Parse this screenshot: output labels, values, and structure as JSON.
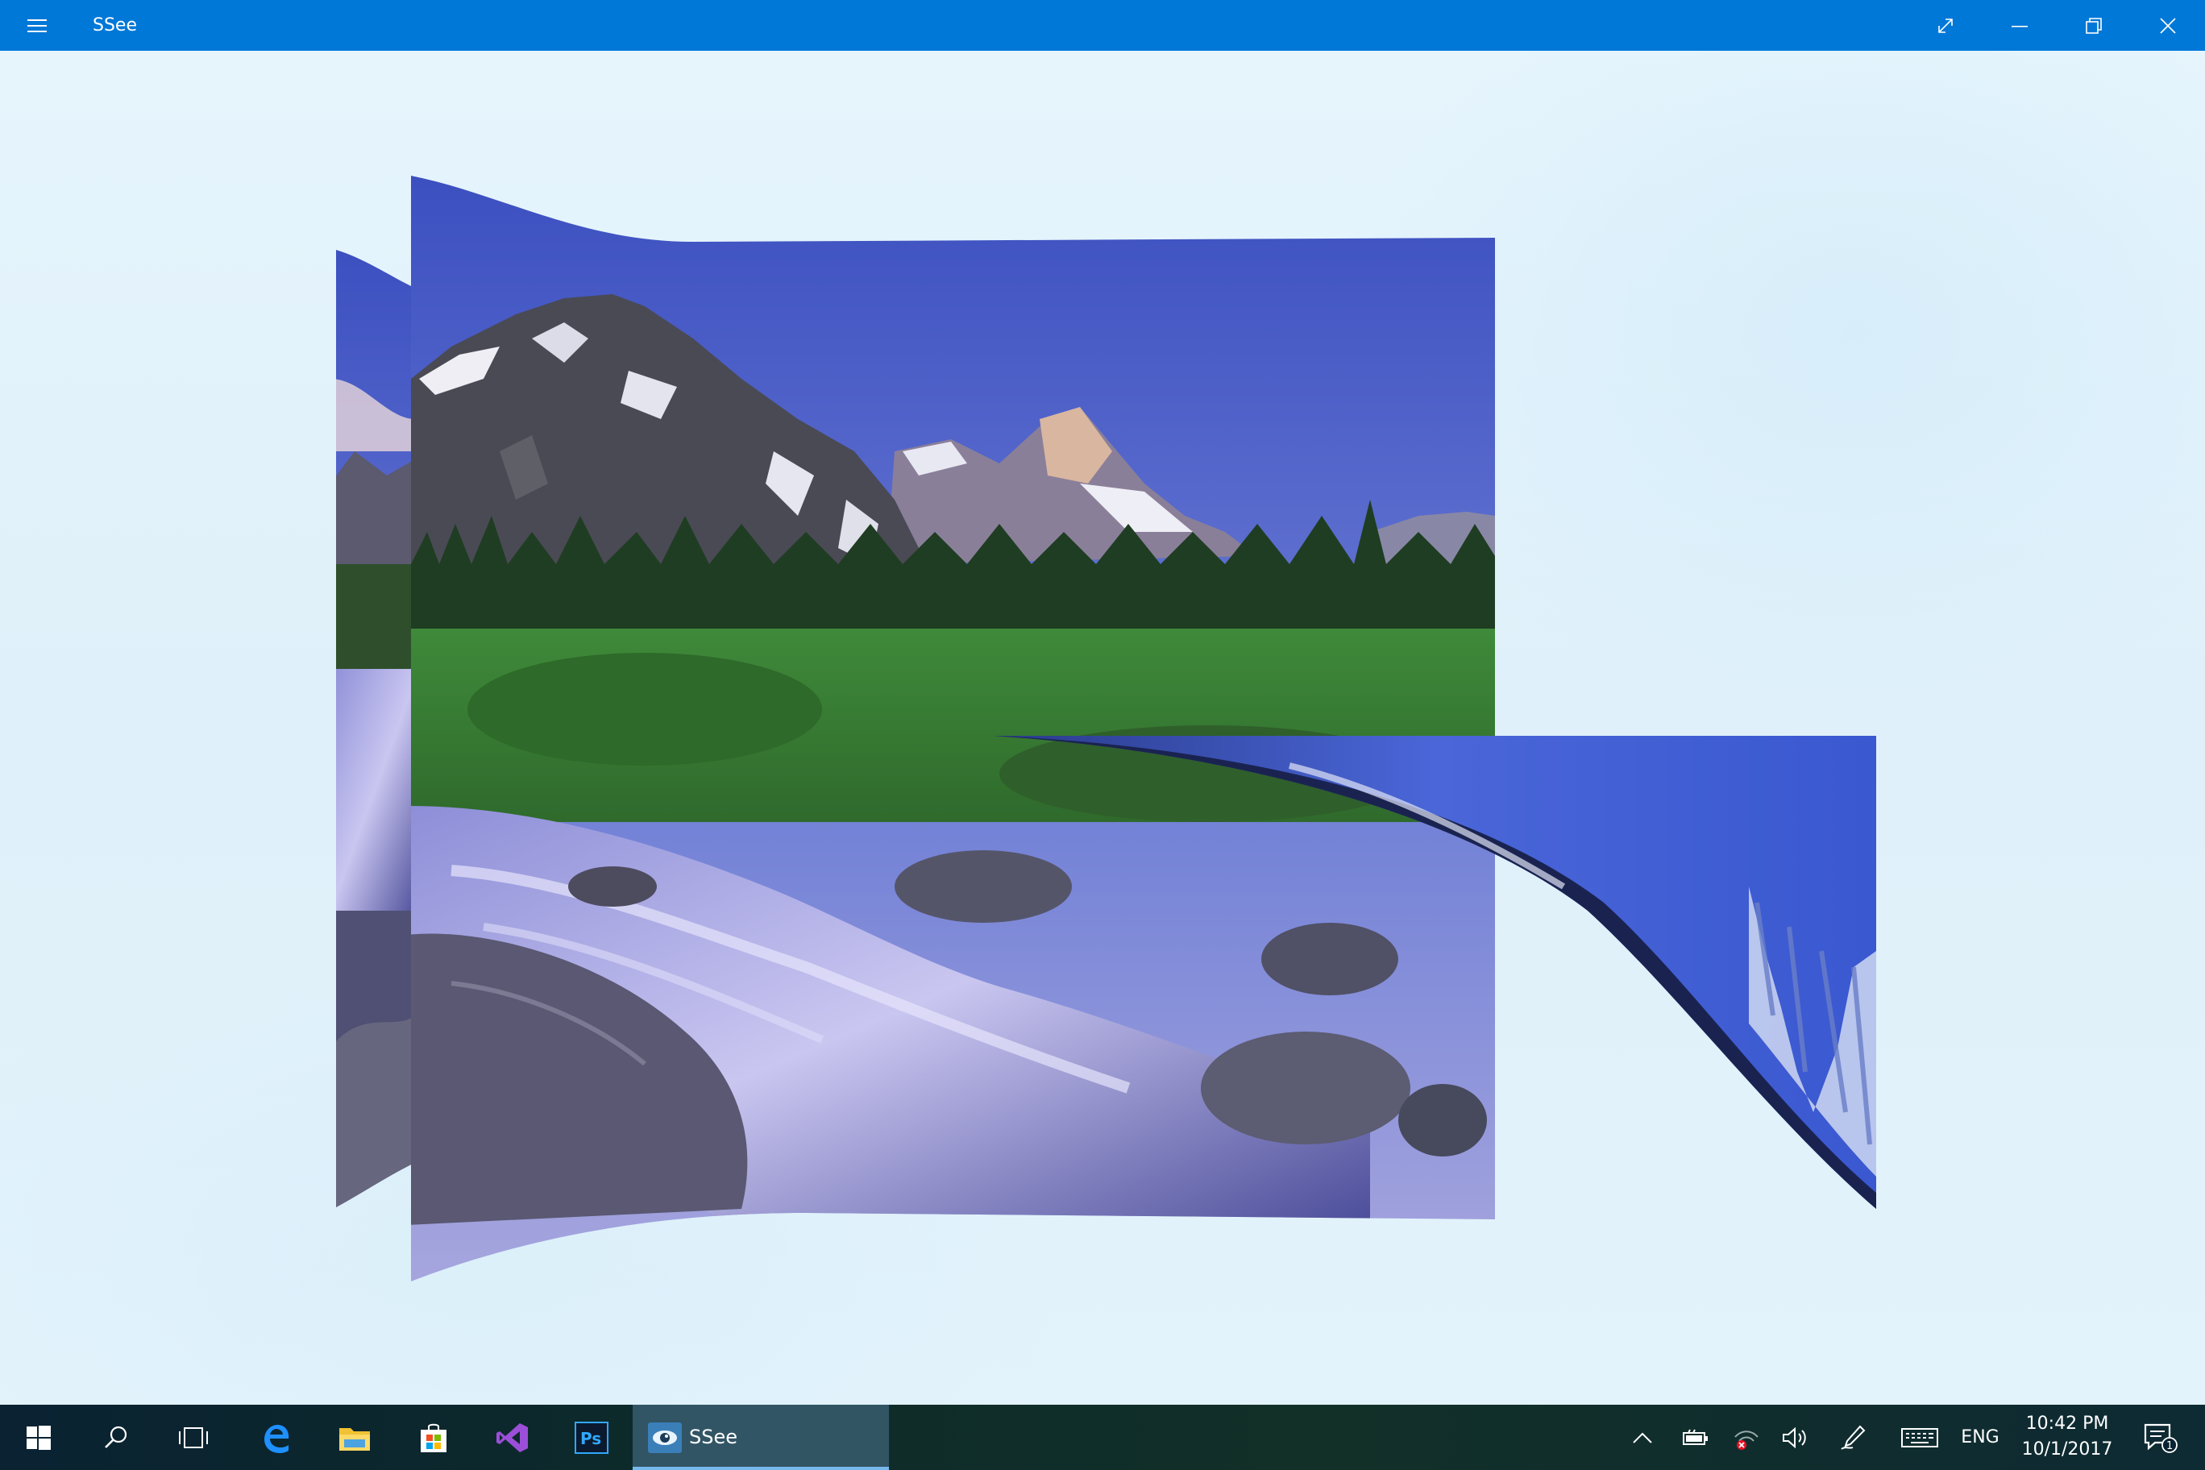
{
  "window": {
    "title": "SSee"
  },
  "taskbar": {
    "pinned_apps": [
      "start-icon",
      "search-icon",
      "task-view-icon",
      "edge-icon",
      "file-explorer-icon",
      "store-icon",
      "visual-studio-icon",
      "photoshop-icon"
    ],
    "photoshop_label": "Ps",
    "active_app": {
      "label": "SSee",
      "icon": "ssee-eye-icon"
    },
    "tray": {
      "language": "ENG",
      "time": "10:42 PM",
      "date": "10/1/2017",
      "notification_count": "1"
    }
  },
  "colors": {
    "titlebar": "#0078d7",
    "background": "#e4f3fb",
    "taskbar_accent": "#76b9ed"
  }
}
